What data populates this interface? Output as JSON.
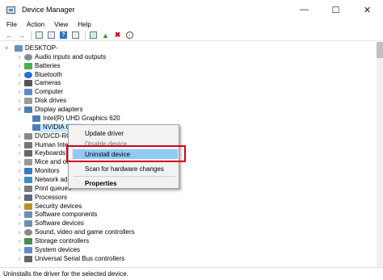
{
  "window": {
    "title": "Device Manager",
    "min": "—",
    "max": "☐",
    "close": "✕"
  },
  "menu": [
    "File",
    "Action",
    "View",
    "Help"
  ],
  "tree": {
    "root": "DESKTOP-",
    "categories": [
      "Audio inputs and outputs",
      "Batteries",
      "Bluetooth",
      "Cameras",
      "Computer",
      "Disk drives",
      "Display adapters",
      "Intel(R) UHD Graphics 620",
      "NVIDIA Ge",
      "DVD/CD-ROM",
      "Human Interf",
      "Keyboards",
      "Mice and oth",
      "Monitors",
      "Network adap",
      "Print queues",
      "Processors",
      "Security devices",
      "Software components",
      "Software devices",
      "Sound, video and game controllers",
      "Storage controllers",
      "System devices",
      "Universal Serial Bus controllers"
    ]
  },
  "context_menu": {
    "update": "Update driver",
    "disable": "Disable device",
    "uninstall": "Uninstall device",
    "scan": "Scan for hardware changes",
    "properties": "Properties"
  },
  "status": "Uninstalls the driver for the selected device.",
  "colors": {
    "selection": "#cce8ff",
    "highlight": "#91c9f7",
    "annotation": "#d0021b"
  }
}
